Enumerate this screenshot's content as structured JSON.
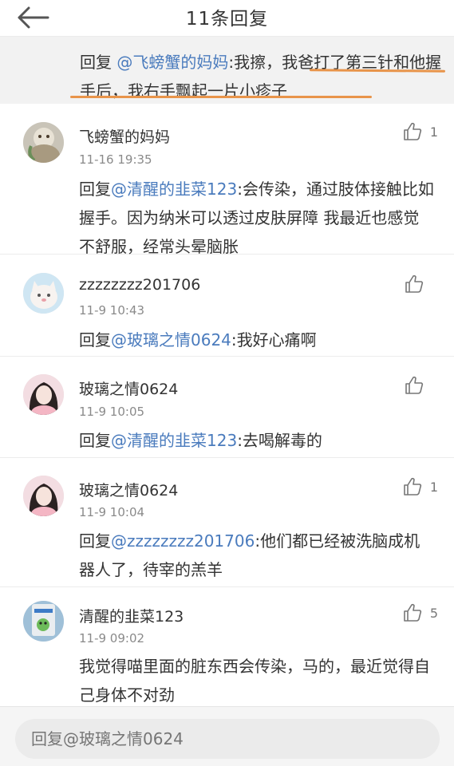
{
  "header": {
    "title": "11条回复"
  },
  "quote": {
    "prefix": "回复 ",
    "mention": "@飞螃蟹的妈妈",
    "text": ":我擦，我爸打了第三针和他握手后，我右手飘起一片小疹子"
  },
  "comments": [
    {
      "username": "飞螃蟹的妈妈",
      "time": "11-16 19:35",
      "reply_prefix": "回复",
      "mention": "@清醒的韭菜123",
      "text": ":会传染，通过肢体接触比如握手。因为纳米可以透过皮肤屏障 我最近也感觉不舒服，经常头晕脑胀",
      "likes": "1"
    },
    {
      "username": "zzzzzzzz201706",
      "time": "11-9 10:43",
      "reply_prefix": "回复",
      "mention": "@玻璃之情0624",
      "text": ":我好心痛啊",
      "likes": ""
    },
    {
      "username": "玻璃之情0624",
      "time": "11-9 10:05",
      "reply_prefix": "回复",
      "mention": "@清醒的韭菜123",
      "text": ":去喝解毒的",
      "likes": ""
    },
    {
      "username": "玻璃之情0624",
      "time": "11-9 10:04",
      "reply_prefix": "回复",
      "mention": "@zzzzzzzz201706",
      "text": ":他们都已经被洗脑成机器人了，待宰的羔羊",
      "likes": "1"
    },
    {
      "username": "清醒的韭菜123",
      "time": "11-9 09:02",
      "reply_prefix": "",
      "mention": "",
      "text": "我觉得喵里面的脏东西会传染，马的，最近觉得自己身体不对劲",
      "likes": "5"
    }
  ],
  "reply_bar": {
    "placeholder": "回复@玻璃之情0624"
  },
  "colors": {
    "mention": "#4a7bbd",
    "underline": "#e8944a",
    "timestamp": "#8a8a8a"
  }
}
